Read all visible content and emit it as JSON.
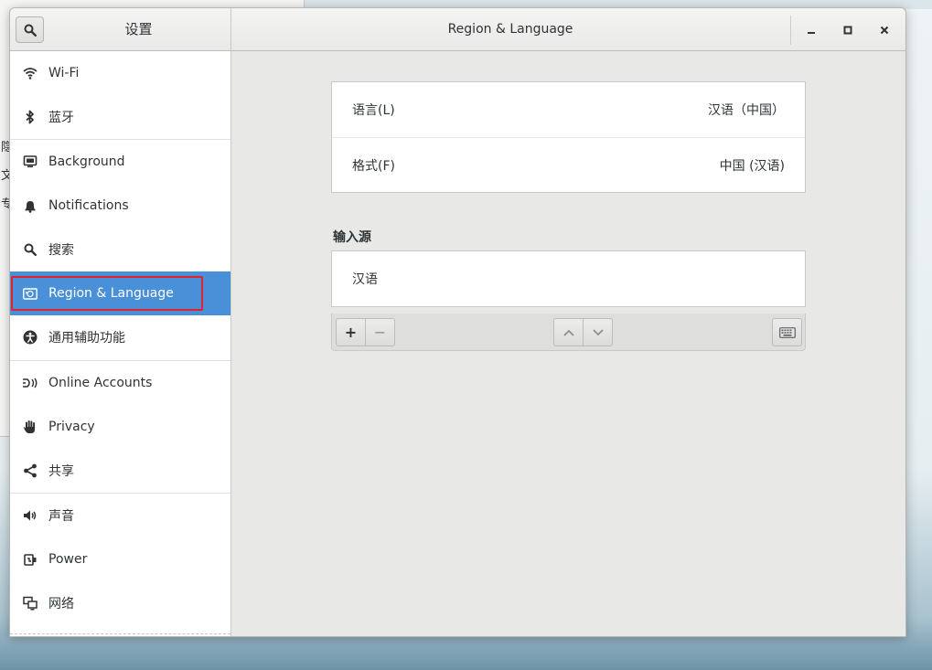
{
  "background_window": {
    "fragments": [
      "隐",
      "文",
      "专"
    ]
  },
  "titlebar": {
    "app_title": "设置",
    "panel_title": "Region & Language",
    "controls": {
      "minimize": "minimize-icon",
      "maximize": "maximize-icon",
      "close": "close-icon"
    }
  },
  "sidebar": {
    "items": [
      {
        "label": "Wi-Fi",
        "icon": "wifi-icon"
      },
      {
        "label": "蓝牙",
        "icon": "bluetooth-icon"
      },
      {
        "label": "Background",
        "icon": "background-icon"
      },
      {
        "label": "Notifications",
        "icon": "bell-icon"
      },
      {
        "label": "搜索",
        "icon": "search-icon"
      },
      {
        "label": "Region & Language",
        "icon": "region-icon",
        "selected": true
      },
      {
        "label": "通用辅助功能",
        "icon": "accessibility-icon"
      },
      {
        "label": "Online Accounts",
        "icon": "online-accounts-icon"
      },
      {
        "label": "Privacy",
        "icon": "hand-icon"
      },
      {
        "label": "共享",
        "icon": "share-icon"
      },
      {
        "label": "声音",
        "icon": "speaker-icon"
      },
      {
        "label": "Power",
        "icon": "power-icon"
      },
      {
        "label": "网络",
        "icon": "network-icon"
      }
    ]
  },
  "region": {
    "language_label": "语言(L)",
    "language_value": "汉语（中国）",
    "formats_label": "格式(F)",
    "formats_value": "中国 (汉语)",
    "input_sources_heading": "输入源",
    "input_sources": [
      "汉语"
    ],
    "toolbar": {
      "add_label": "+",
      "remove_label": "−"
    }
  },
  "colors": {
    "selection": "#4a90d9",
    "highlight_outline": "#e0202a"
  }
}
